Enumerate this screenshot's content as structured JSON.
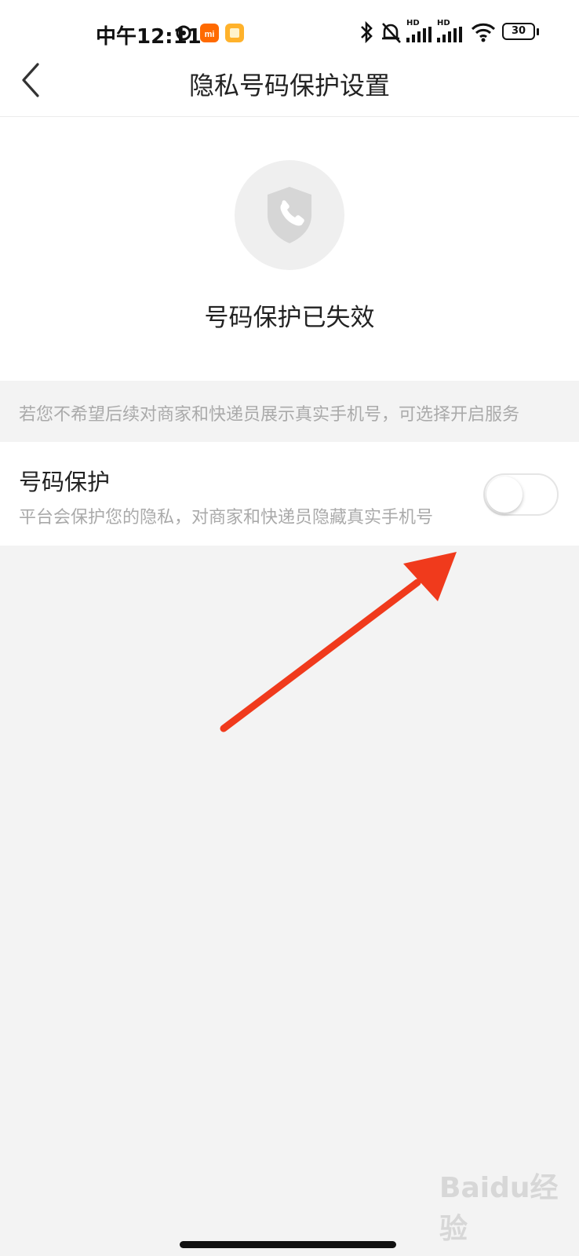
{
  "status_bar": {
    "time": "中午12:11",
    "battery": "30",
    "signal_labels": [
      "HD",
      "HD"
    ]
  },
  "header": {
    "title": "隐私号码保护设置",
    "back_icon": "chevron-left-icon"
  },
  "hero": {
    "icon": "shield-phone-icon",
    "status_text": "号码保护已失效"
  },
  "tip": {
    "text": "若您不希望后续对商家和快递员展示真实手机号，可选择开启服务"
  },
  "setting": {
    "label": "号码保护",
    "description": "平台会保护您的隐私，对商家和快递员隐藏真实手机号",
    "enabled": false
  },
  "annotation": {
    "arrow_color": "#f03a1c"
  },
  "watermark": {
    "text": "Baidu经验"
  }
}
